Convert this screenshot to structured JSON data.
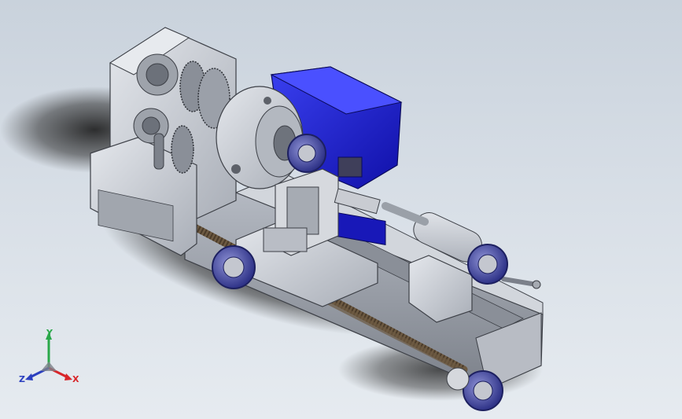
{
  "triad": {
    "x_label": "X",
    "y_label": "Y",
    "z_label": "Z",
    "x_color": "#d8262a",
    "y_color": "#2aa84a",
    "z_color": "#2b3fbf"
  },
  "scene": {
    "background_top": "#c9d2dc",
    "background_bottom": "#e6ebf0",
    "part_color": "#c8ccd4",
    "motor_color": "#1b1fd0",
    "handwheel_color": "#4a4fa8"
  }
}
